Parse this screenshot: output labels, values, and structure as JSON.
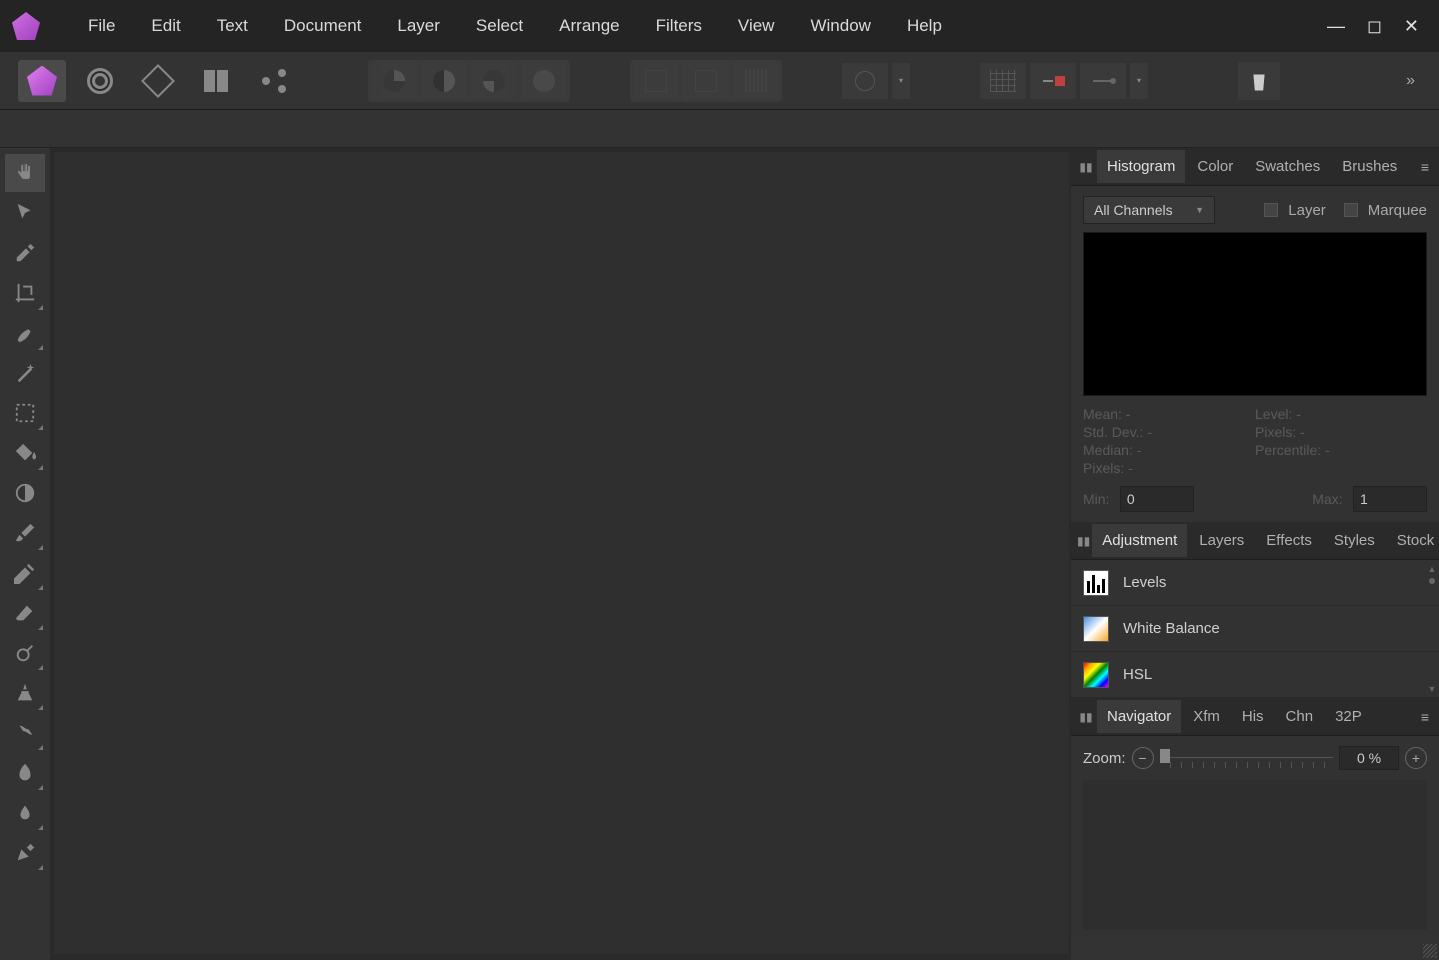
{
  "menu": {
    "items": [
      "File",
      "Edit",
      "Text",
      "Document",
      "Layer",
      "Select",
      "Arrange",
      "Filters",
      "View",
      "Window",
      "Help"
    ]
  },
  "windowControls": {
    "min": "—",
    "max": "◻",
    "close": "✕"
  },
  "toolbar": {
    "overflow": "»"
  },
  "rightPanels": {
    "group1": {
      "tabs": [
        "Histogram",
        "Color",
        "Swatches",
        "Brushes"
      ],
      "active": 0
    },
    "histogram": {
      "channelDropdown": "All Channels",
      "layerChk": "Layer",
      "marqueeChk": "Marquee",
      "stats": {
        "mean": "Mean: -",
        "stddev": "Std. Dev.: -",
        "median": "Median: -",
        "pixels": "Pixels: -",
        "level": "Level: -",
        "pixels2": "Pixels: -",
        "percentile": "Percentile: -"
      },
      "minLabel": "Min:",
      "maxLabel": "Max:",
      "minVal": "0",
      "maxVal": "1"
    },
    "group2": {
      "tabs": [
        "Adjustment",
        "Layers",
        "Effects",
        "Styles",
        "Stock"
      ],
      "active": 0
    },
    "adjustments": {
      "items": [
        {
          "label": "Levels"
        },
        {
          "label": "White Balance"
        },
        {
          "label": "HSL"
        }
      ]
    },
    "group3": {
      "tabs": [
        "Navigator",
        "Xfm",
        "His",
        "Chn",
        "32P"
      ],
      "active": 0
    },
    "navigator": {
      "zoomLabel": "Zoom:",
      "zoomValue": "0 %"
    }
  },
  "leftTools": [
    {
      "name": "view-tool",
      "sel": true,
      "tri": false
    },
    {
      "name": "move-tool",
      "sel": false,
      "tri": false
    },
    {
      "name": "color-picker-tool",
      "sel": false,
      "tri": false
    },
    {
      "name": "crop-tool",
      "sel": false,
      "tri": true
    },
    {
      "name": "selection-brush-tool",
      "sel": false,
      "tri": true
    },
    {
      "name": "magic-wand-tool",
      "sel": false,
      "tri": false
    },
    {
      "name": "marquee-tool",
      "sel": false,
      "tri": true
    },
    {
      "name": "flood-fill-tool",
      "sel": false,
      "tri": true
    },
    {
      "name": "gradient-tool",
      "sel": false,
      "tri": false
    },
    {
      "name": "paint-brush-tool",
      "sel": false,
      "tri": true
    },
    {
      "name": "pencil-tool",
      "sel": false,
      "tri": true
    },
    {
      "name": "erase-brush-tool",
      "sel": false,
      "tri": true
    },
    {
      "name": "dodge-tool",
      "sel": false,
      "tri": true
    },
    {
      "name": "clone-tool",
      "sel": false,
      "tri": true
    },
    {
      "name": "inpaint-tool",
      "sel": false,
      "tri": true
    },
    {
      "name": "smudge-tool",
      "sel": false,
      "tri": true
    },
    {
      "name": "blur-tool",
      "sel": false,
      "tri": true
    },
    {
      "name": "pen-tool",
      "sel": false,
      "tri": true
    }
  ]
}
